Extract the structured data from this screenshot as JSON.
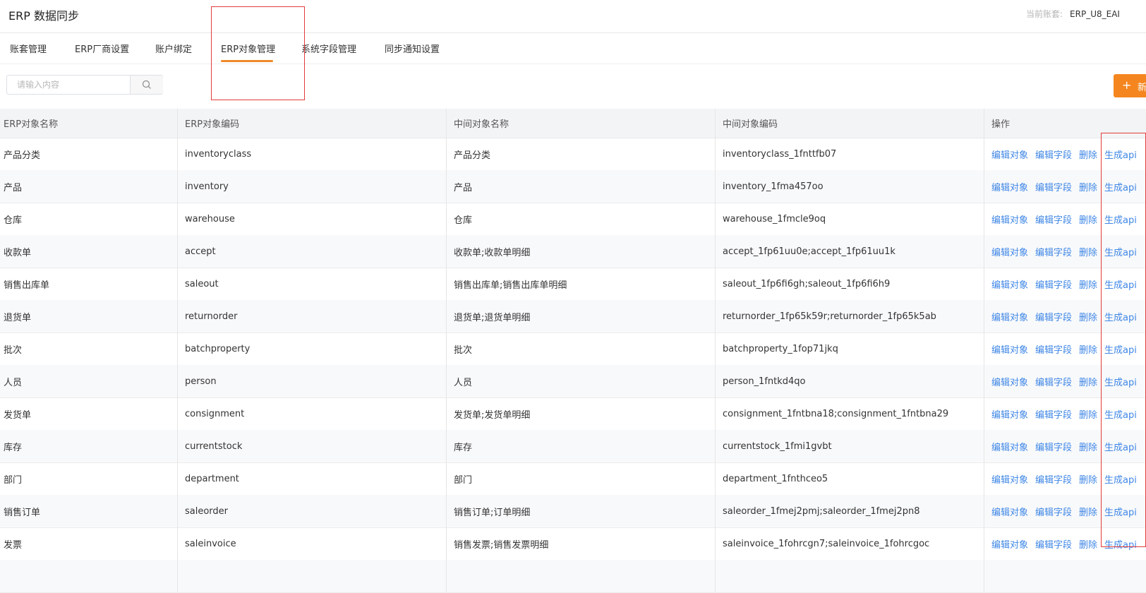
{
  "header": {
    "title": "ERP 数据同步",
    "account_label": "当前账套:",
    "account_value": "ERP_U8_EAI"
  },
  "tabs": [
    {
      "label": "账套管理",
      "active": false
    },
    {
      "label": "ERP厂商设置",
      "active": false
    },
    {
      "label": "账户绑定",
      "active": false
    },
    {
      "label": "ERP对象管理",
      "active": true
    },
    {
      "label": "系统字段管理",
      "active": false
    },
    {
      "label": "同步通知设置",
      "active": false
    }
  ],
  "toolbar": {
    "search_placeholder": "请输入内容",
    "search_icon": "search-icon",
    "add_plus": "+",
    "add_label": "新"
  },
  "table": {
    "columns": [
      "ERP对象名称",
      "ERP对象编码",
      "中间对象名称",
      "中间对象编码",
      "操作"
    ],
    "actions": [
      "编辑对象",
      "编辑字段",
      "删除",
      "生成api"
    ],
    "rows": [
      {
        "name": "产品分类",
        "code": "inventoryclass",
        "mid_name": "产品分类",
        "mid_code": "inventoryclass_1fnttfb07"
      },
      {
        "name": "产品",
        "code": "inventory",
        "mid_name": "产品",
        "mid_code": "inventory_1fma457oo"
      },
      {
        "name": "仓库",
        "code": "warehouse",
        "mid_name": "仓库",
        "mid_code": "warehouse_1fmcle9oq"
      },
      {
        "name": "收款单",
        "code": "accept",
        "mid_name": "收款单;收款单明细",
        "mid_code": "accept_1fp61uu0e;accept_1fp61uu1k"
      },
      {
        "name": "销售出库单",
        "code": "saleout",
        "mid_name": "销售出库单;销售出库单明细",
        "mid_code": "saleout_1fp6fi6gh;saleout_1fp6fi6h9"
      },
      {
        "name": "退货单",
        "code": "returnorder",
        "mid_name": "退货单;退货单明细",
        "mid_code": "returnorder_1fp65k59r;returnorder_1fp65k5ab"
      },
      {
        "name": "批次",
        "code": "batchproperty",
        "mid_name": "批次",
        "mid_code": "batchproperty_1fop71jkq"
      },
      {
        "name": "人员",
        "code": "person",
        "mid_name": "人员",
        "mid_code": "person_1fntkd4qo"
      },
      {
        "name": "发货单",
        "code": "consignment",
        "mid_name": "发货单;发货单明细",
        "mid_code": "consignment_1fntbna18;consignment_1fntbna29"
      },
      {
        "name": "库存",
        "code": "currentstock",
        "mid_name": "库存",
        "mid_code": "currentstock_1fmi1gvbt"
      },
      {
        "name": "部门",
        "code": "department",
        "mid_name": "部门",
        "mid_code": "department_1fnthceo5"
      },
      {
        "name": "销售订单",
        "code": "saleorder",
        "mid_name": "销售订单;订单明细",
        "mid_code": "saleorder_1fmej2pmj;saleorder_1fmej2pn8"
      },
      {
        "name": "发票",
        "code": "saleinvoice",
        "mid_name": "销售发票;销售发票明细",
        "mid_code": "saleinvoice_1fohrcgn7;saleinvoice_1fohrcgoc"
      },
      {
        "name": "",
        "code": "",
        "mid_name": "",
        "mid_code": ""
      }
    ]
  },
  "colors": {
    "accent": "#f5861f",
    "link": "#3f87e6",
    "highlight": "#e23b3b"
  }
}
